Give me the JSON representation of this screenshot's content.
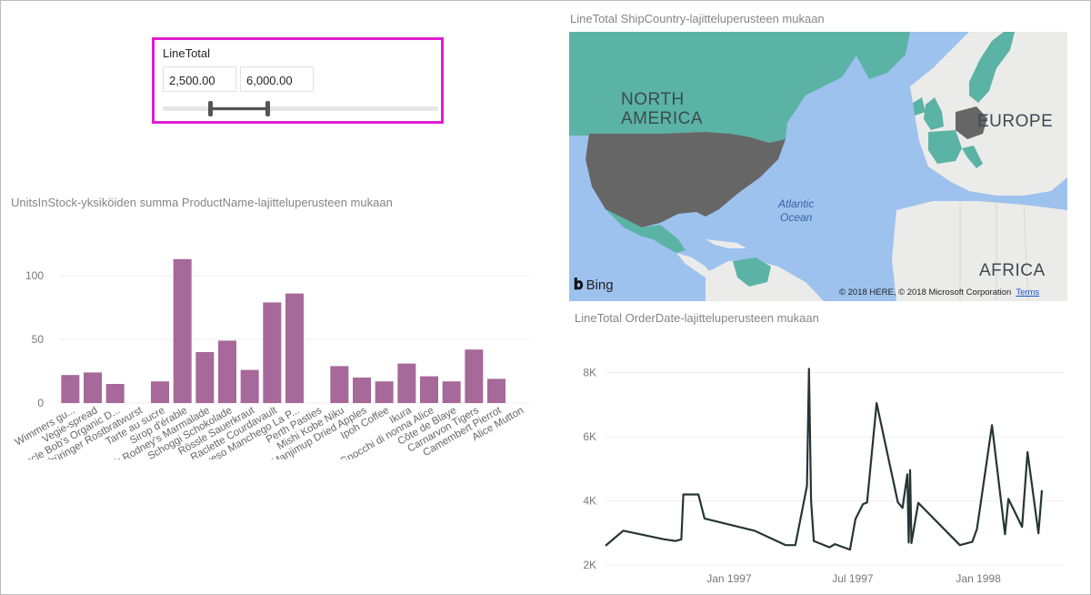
{
  "slicer": {
    "title": "LineTotal",
    "min_value": "2,500.00",
    "max_value": "6,000.00",
    "range_start": 0.17,
    "range_end": 0.38
  },
  "bar_visual": {
    "title": "UnitsInStock-yksiköiden summa ProductName-lajitteluperusteen mukaan"
  },
  "map_visual": {
    "title": "LineTotal ShipCountry-lajitteluperusteen mukaan",
    "labels": {
      "north_america": "NORTH\nAMERICA",
      "europe": "EUROPE",
      "africa": "AFRICA",
      "ocean": "Atlantic\nOcean"
    },
    "bing": "Bing",
    "copyright": "© 2018 HERE, © 2018 Microsoft Corporation",
    "terms": "Terms",
    "colors": {
      "water": "#9ec2ee",
      "land": "#ebebea",
      "highlight": "#5bb3a5",
      "selected": "#666666"
    }
  },
  "line_visual": {
    "title": "LineTotal OrderDate-lajitteluperusteen mukaan"
  },
  "chart_data": [
    {
      "type": "bar",
      "title": "UnitsInStock-yksiköiden summa ProductName-lajitteluperusteen mukaan",
      "categories": [
        "Wimmers gu...",
        "Vegie-spread",
        "Uncle Bob's Organic D...",
        "Thüringer Rostbratwurst",
        "Tarte au sucre",
        "Sirop d'érable",
        "Sir Rodney's Marmalade",
        "Schoggi Schokolade",
        "Rössle Sauerkraut",
        "Raclette Courdavault",
        "Queso Manchego La P...",
        "Perth Pasties",
        "Mishi Kobe Niku",
        "Manjimup Dried Apples",
        "Ipoh Coffee",
        "Ikura",
        "Gnocchi di nonna Alice",
        "Côte de Blaye",
        "Carnarvon Tigers",
        "Camembert Pierrot",
        "Alice Mutton"
      ],
      "bar_values": [
        22,
        24,
        15,
        0,
        17,
        113,
        40,
        49,
        26,
        79,
        86,
        0,
        29,
        20,
        17,
        31,
        21,
        17,
        42,
        19,
        0
      ],
      "ylim": [
        0,
        120
      ],
      "yticks": [
        "0",
        "50",
        "100"
      ],
      "ytick_values": [
        0,
        50,
        100
      ],
      "color": "#a66999"
    },
    {
      "type": "line",
      "title": "LineTotal OrderDate-lajitteluperusteen mukaan",
      "x_tick_labels": [
        "Jan 1997",
        "Jul 1997",
        "Jan 1998"
      ],
      "x_ticks": [
        "1997-01-01",
        "1997-07-01",
        "1998-01-01"
      ],
      "x_range": [
        "1996-07-04",
        "1998-05-06"
      ],
      "ylim": [
        2000,
        8500
      ],
      "yticks": [
        "2K",
        "4K",
        "6K",
        "8K"
      ],
      "ytick_values": [
        2000,
        4000,
        6000,
        8000
      ],
      "color": "#263535",
      "points": [
        [
          "1996-07-04",
          2600
        ],
        [
          "1996-07-30",
          3070
        ],
        [
          "1996-09-28",
          2800
        ],
        [
          "1996-10-15",
          2750
        ],
        [
          "1996-10-23",
          2800
        ],
        [
          "1996-10-26",
          4200
        ],
        [
          "1996-11-17",
          4200
        ],
        [
          "1996-11-26",
          3450
        ],
        [
          "1997-02-07",
          3070
        ],
        [
          "1997-03-25",
          2620
        ],
        [
          "1997-04-08",
          2620
        ],
        [
          "1997-04-25",
          4470
        ],
        [
          "1997-04-28",
          8120
        ],
        [
          "1997-05-01",
          4000
        ],
        [
          "1997-05-05",
          2750
        ],
        [
          "1997-05-28",
          2550
        ],
        [
          "1997-06-05",
          2650
        ],
        [
          "1997-06-27",
          2480
        ],
        [
          "1997-07-05",
          3430
        ],
        [
          "1997-07-16",
          3900
        ],
        [
          "1997-07-22",
          3950
        ],
        [
          "1997-08-05",
          7050
        ],
        [
          "1997-09-05",
          3960
        ],
        [
          "1997-09-12",
          3780
        ],
        [
          "1997-09-19",
          4830
        ],
        [
          "1997-09-21",
          2700
        ],
        [
          "1997-09-23",
          4960
        ],
        [
          "1997-09-25",
          2680
        ],
        [
          "1997-10-05",
          3940
        ],
        [
          "1997-12-05",
          2620
        ],
        [
          "1997-12-23",
          2720
        ],
        [
          "1997-12-30",
          3130
        ],
        [
          "1998-01-21",
          6360
        ],
        [
          "1998-02-09",
          2960
        ],
        [
          "1998-02-14",
          4060
        ],
        [
          "1998-03-06",
          3190
        ],
        [
          "1998-03-14",
          5520
        ],
        [
          "1998-03-30",
          2990
        ],
        [
          "1998-04-04",
          4330
        ]
      ]
    }
  ]
}
